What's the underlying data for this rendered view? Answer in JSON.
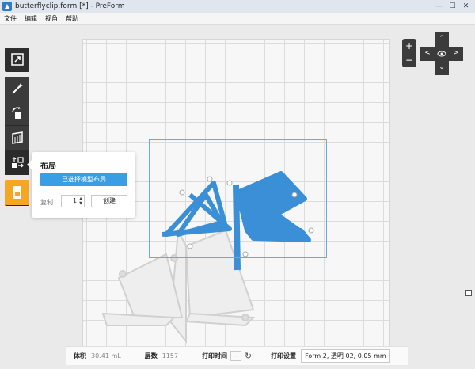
{
  "window": {
    "title": "butterflyclip.form [*] - PreForm",
    "minimize": "—",
    "maximize": "☐",
    "close": "✕"
  },
  "menu": [
    "文件",
    "编辑",
    "视角",
    "帮助"
  ],
  "toolbar": {
    "tools": [
      "expand-icon",
      "magic-wand-icon",
      "rotate-icon",
      "supports-icon",
      "layout-icon",
      "print-icon"
    ],
    "accent": "#f5a623"
  },
  "layout_panel": {
    "title": "布局",
    "auto_layout_button": "已选择模型布局",
    "copies_label": "复制",
    "copies_value": "1",
    "create_button": "创建"
  },
  "view_controls": {
    "zoom_in": "+",
    "zoom_out": "−",
    "up": "⌃",
    "down": "⌄",
    "left": "<",
    "right": ">"
  },
  "status": {
    "volume_label": "体积",
    "volume_value": "30.41 mL",
    "layers_label": "层数",
    "layers_value": "1157",
    "print_time_label": "打印时间",
    "print_time_value": "--",
    "print_settings_label": "打印设置",
    "print_settings_value": "Form 2, 透明 02, 0.05 mm"
  },
  "colors": {
    "model_blue": "#3a8fd6",
    "ghost": "#e6e6e6",
    "toolbar_dark": "#3b3b3b",
    "button_blue": "#3a9ee4"
  }
}
